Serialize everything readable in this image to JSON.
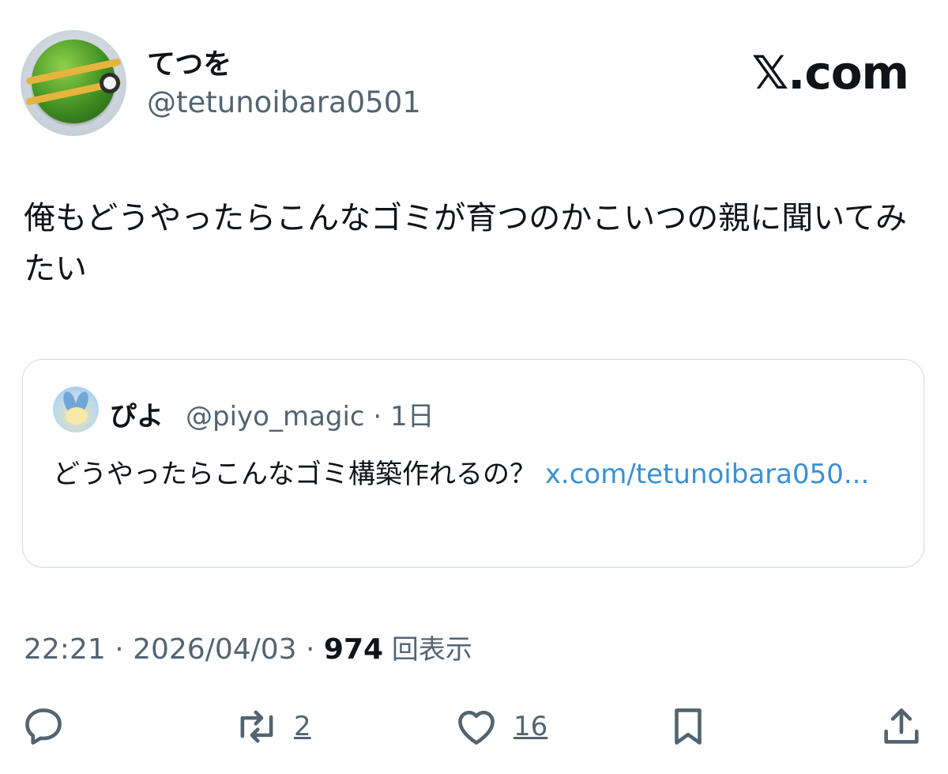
{
  "author": {
    "display_name": "てつを",
    "handle": "@tetunoibara0501",
    "avatar_icon": "ball-avatar-icon"
  },
  "brand": {
    "logo_text": "𝕏.com"
  },
  "post": {
    "text": "俺もどうやったらこんなゴミが育つのかこいつの親に聞いてみたい"
  },
  "quote": {
    "display_name": "ぴよ",
    "handle_line": "@piyo_magic · 1日",
    "text": "どうやったらこんなゴミ構築作れるの？ ",
    "link_text": "x.com/tetunoibara050..."
  },
  "meta": {
    "time_date": "22:21 · 2026/04/03 · ",
    "views_count": "974",
    "views_suffix": " 回表示"
  },
  "actions": {
    "reply": {
      "icon": "reply-icon",
      "count": ""
    },
    "repost": {
      "icon": "repost-icon",
      "count": "2"
    },
    "like": {
      "icon": "heart-icon",
      "count": "16"
    },
    "bookmark": {
      "icon": "bookmark-icon",
      "count": ""
    },
    "share": {
      "icon": "share-icon",
      "count": ""
    }
  },
  "colors": {
    "link": "#3a8fd6",
    "secondary_text": "#536471",
    "border": "#cfd9de"
  }
}
